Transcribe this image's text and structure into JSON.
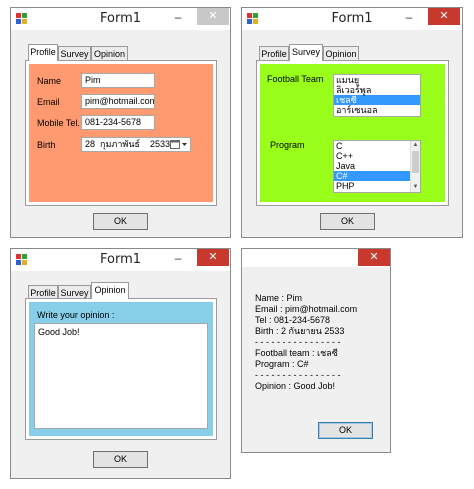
{
  "form1": {
    "title": "Form1",
    "tabs": [
      "Profile",
      "Survey",
      "Opinion"
    ],
    "labels": {
      "name": "Name",
      "email": "Email",
      "mobile": "Mobile Tel.",
      "birth": "Birth"
    },
    "values": {
      "name": "Pim",
      "email": "pim@hotmail.com",
      "mobile": "081-234-5678",
      "birth_day": "28",
      "birth_month": "กุมภาพันธ์",
      "birth_year": "2533"
    },
    "ok_label": "OK"
  },
  "form2": {
    "title": "Form1",
    "tabs": [
      "Profile",
      "Survey",
      "Opinion"
    ],
    "football_label": "Football Team",
    "football_items": [
      "แมนยู",
      "ลิเวอร์พูล",
      "เชลซี",
      "อาร์เซนอล"
    ],
    "football_selected": 2,
    "program_label": "Program",
    "program_items": [
      "C",
      "C++",
      "Java",
      "C#",
      "PHP"
    ],
    "program_selected": 3,
    "ok_label": "OK"
  },
  "form3": {
    "title": "Form1",
    "tabs": [
      "Profile",
      "Survey",
      "Opinion"
    ],
    "prompt": "Write your opinion :",
    "opinion_text": "Good Job!",
    "ok_label": "OK"
  },
  "form4": {
    "summary": [
      "Name : Pim",
      "Email : pim@hotmail.com",
      "Tel : 081-234-5678",
      "Birth : 2 กันยายน 2533",
      "- - - - - - - - - - - - - - - -",
      "Football team : เชลซี",
      "Program : C#",
      "- - - - - - - - - - - - - - - -",
      "Opinion : Good Job!"
    ],
    "ok_label": "OK"
  },
  "colors": {
    "profile_bg": "#ff9a70",
    "survey_bg": "#99ff1a",
    "opinion_bg": "#87cee8",
    "close_red": "#c7392c"
  },
  "icons": {
    "app": "form-app-icon",
    "minimize": "minimize-icon",
    "close": "close-icon",
    "calendar": "calendar-icon"
  }
}
